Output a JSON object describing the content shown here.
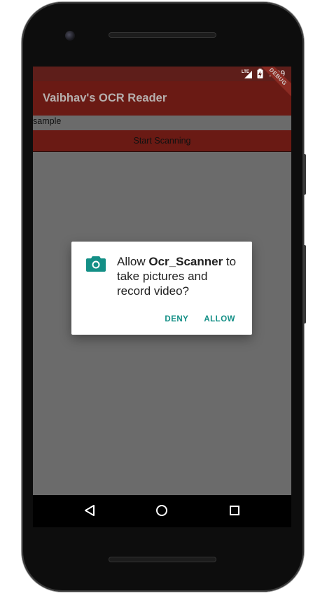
{
  "status_bar": {
    "time": "1:09",
    "network_icon": "lte-signal-icon",
    "battery_icon": "battery-charging-icon",
    "debug_banner": "DEBUG"
  },
  "app_bar": {
    "title": "Vaibhav's OCR Reader"
  },
  "content": {
    "sample_text": "sample",
    "scan_button_label": "Start Scanning"
  },
  "permission_dialog": {
    "icon": "camera-icon",
    "message_prefix": "Allow ",
    "app_name": "Ocr_Scanner",
    "message_suffix": " to take pictures and record video?",
    "deny_label": "DENY",
    "allow_label": "ALLOW"
  },
  "nav_bar": {
    "back_icon": "back-triangle-icon",
    "home_icon": "home-circle-icon",
    "recents_icon": "recents-square-icon"
  },
  "colors": {
    "accent": "#138f86",
    "app_bar": "#6a1a14",
    "status_bar": "#5e1e1a",
    "scrim": "#6b6b6b"
  }
}
